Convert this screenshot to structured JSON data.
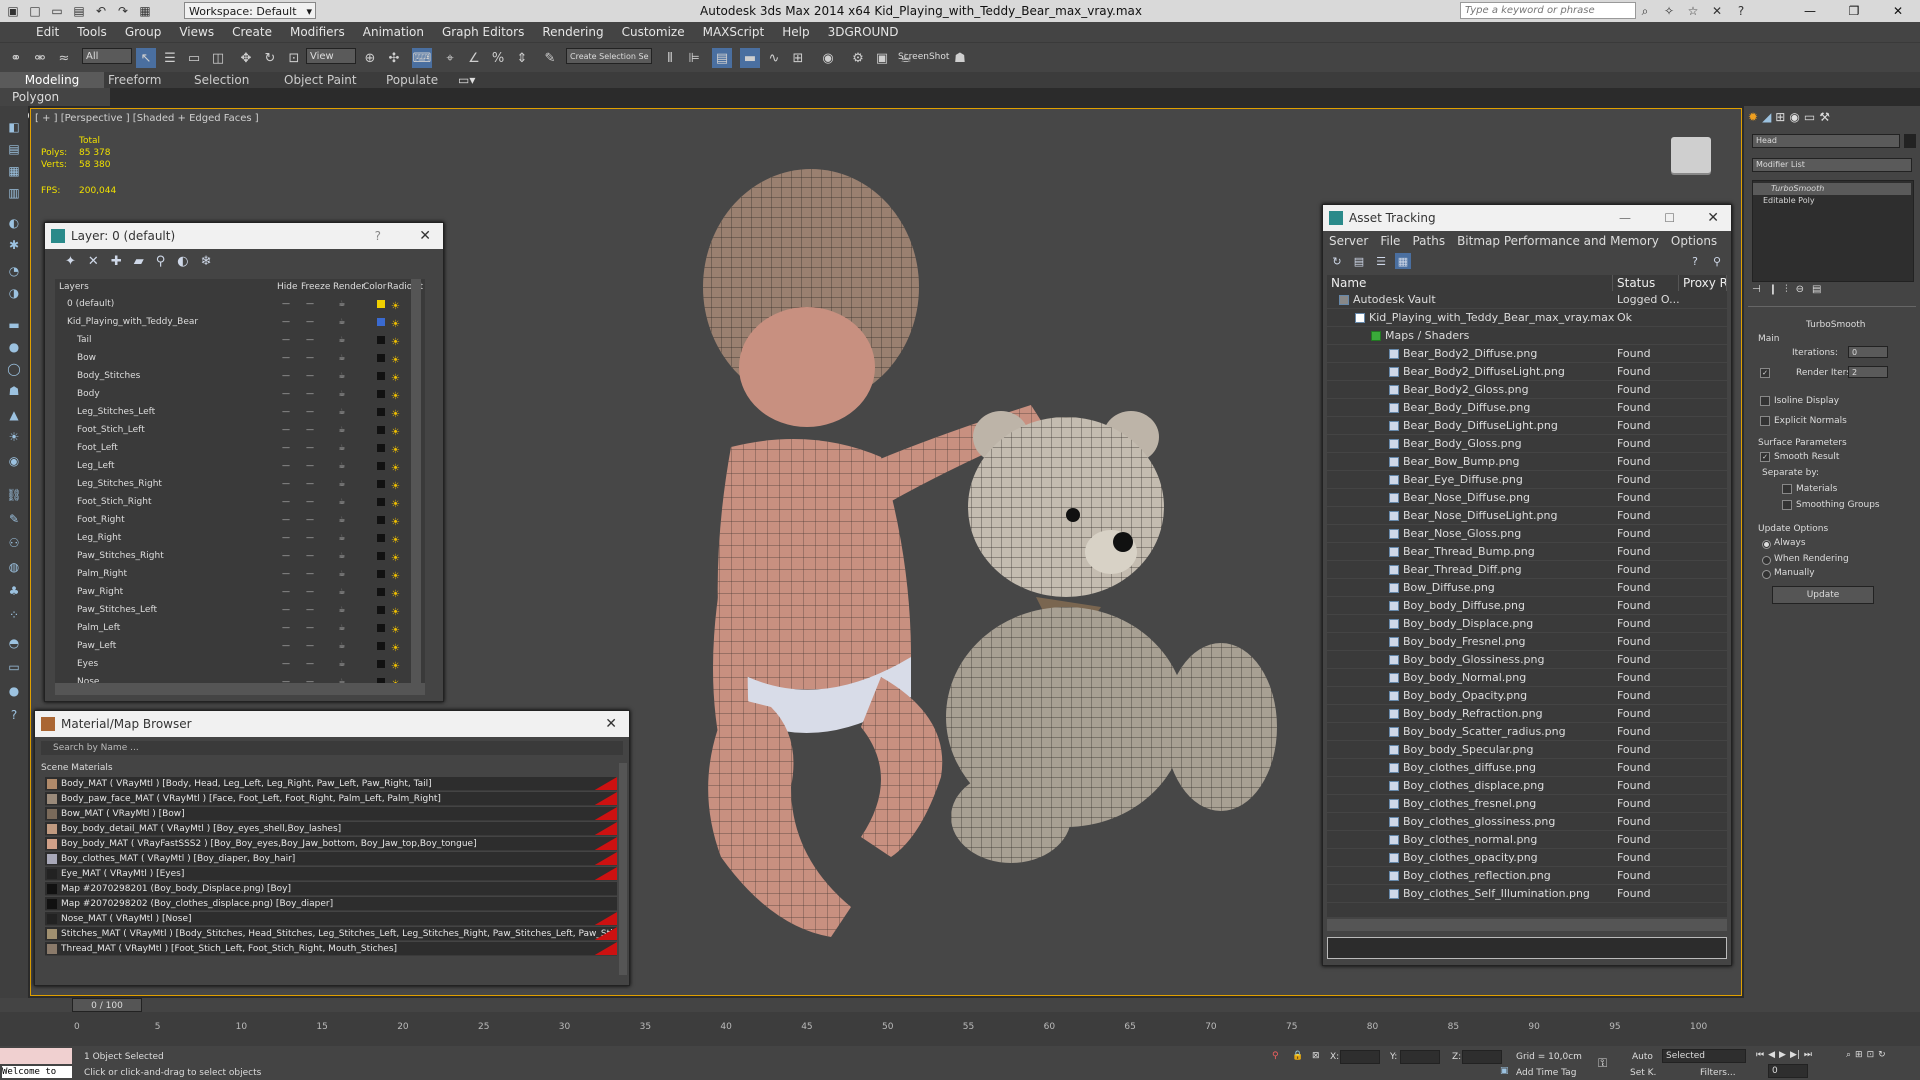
{
  "titlebar": {
    "title": "Autodesk 3ds Max  2014 x64    Kid_Playing_with_Teddy_Bear_max_vray.max",
    "workspace": "Workspace: Default",
    "search_placeholder": "Type a keyword or phrase"
  },
  "menu": [
    "Edit",
    "Tools",
    "Group",
    "Views",
    "Create",
    "Modifiers",
    "Animation",
    "Graph Editors",
    "Rendering",
    "Customize",
    "MAXScript",
    "Help",
    "3DGROUND"
  ],
  "toolbar": {
    "filter": "All",
    "ref_coord": "View",
    "named_sel": "Create Selection Se",
    "screenshot": "ScreenShot"
  },
  "ribbon": {
    "tabs": [
      "Modeling",
      "Freeform",
      "Selection",
      "Object Paint",
      "Populate"
    ],
    "subtab": "Polygon Modeling"
  },
  "viewport": {
    "label": "[ + ] [Perspective ] [Shaded + Edged Faces ]",
    "stats_total": "Total",
    "polys_label": "Polys:",
    "polys": "85 378",
    "verts_label": "Verts:",
    "verts": "58 380",
    "fps_label": "FPS:",
    "fps": "200,044"
  },
  "layer_dialog": {
    "title": "Layer: 0 (default)",
    "help": "?",
    "columns": [
      "Layers",
      "Hide",
      "Freeze",
      "Render",
      "Color",
      "Radiosit"
    ],
    "rows": [
      {
        "name": "0 (default)",
        "indent": 0,
        "color": "#f0d000"
      },
      {
        "name": "Kid_Playing_with_Teddy_Bear",
        "indent": 0,
        "color": "#3a6ad0"
      },
      {
        "name": "Tail",
        "indent": 1,
        "color": "#111111"
      },
      {
        "name": "Bow",
        "indent": 1,
        "color": "#111111"
      },
      {
        "name": "Body_Stitches",
        "indent": 1,
        "color": "#111111"
      },
      {
        "name": "Body",
        "indent": 1,
        "color": "#111111"
      },
      {
        "name": "Leg_Stitches_Left",
        "indent": 1,
        "color": "#111111"
      },
      {
        "name": "Foot_Stich_Left",
        "indent": 1,
        "color": "#111111"
      },
      {
        "name": "Foot_Left",
        "indent": 1,
        "color": "#111111"
      },
      {
        "name": "Leg_Left",
        "indent": 1,
        "color": "#111111"
      },
      {
        "name": "Leg_Stitches_Right",
        "indent": 1,
        "color": "#111111"
      },
      {
        "name": "Foot_Stich_Right",
        "indent": 1,
        "color": "#111111"
      },
      {
        "name": "Foot_Right",
        "indent": 1,
        "color": "#111111"
      },
      {
        "name": "Leg_Right",
        "indent": 1,
        "color": "#111111"
      },
      {
        "name": "Paw_Stitches_Right",
        "indent": 1,
        "color": "#111111"
      },
      {
        "name": "Palm_Right",
        "indent": 1,
        "color": "#111111"
      },
      {
        "name": "Paw_Right",
        "indent": 1,
        "color": "#111111"
      },
      {
        "name": "Paw_Stitches_Left",
        "indent": 1,
        "color": "#111111"
      },
      {
        "name": "Palm_Left",
        "indent": 1,
        "color": "#111111"
      },
      {
        "name": "Paw_Left",
        "indent": 1,
        "color": "#111111"
      },
      {
        "name": "Eyes",
        "indent": 1,
        "color": "#111111"
      },
      {
        "name": "Nose",
        "indent": 1,
        "color": "#111111"
      }
    ]
  },
  "material_browser": {
    "title": "Material/Map Browser",
    "search": "Search by Name ...",
    "section": "Scene Materials",
    "rows": [
      {
        "text": "Body_MAT  ( VRayMtl )  [Body, Head, Leg_Left, Leg_Right, Paw_Left, Paw_Right, Tail]",
        "icon": "#b08a6a",
        "red": true
      },
      {
        "text": "Body_paw_face_MAT  ( VRayMtl )  [Face, Foot_Left, Foot_Right, Palm_Left, Palm_Right]",
        "icon": "#9a8a7a",
        "red": true
      },
      {
        "text": "Bow_MAT  ( VRayMtl )  [Bow]",
        "icon": "#7a6a5a",
        "red": true
      },
      {
        "text": "Boy_body_detail_MAT  ( VRayMtl )  [Boy_eyes_shell,Boy_lashes]",
        "icon": "#c09a80",
        "red": true
      },
      {
        "text": "Boy_body_MAT  ( VRayFastSSS2 )  [Boy_Boy_eyes,Boy_Jaw_bottom, Boy_Jaw_top,Boy_tongue]",
        "icon": "#d0a088",
        "red": true
      },
      {
        "text": "Boy_clothes_MAT  ( VRayMtl )  [Boy_diaper, Boy_hair]",
        "icon": "#a8a8b8",
        "red": true
      },
      {
        "text": "Eye_MAT  ( VRayMtl )  [Eyes]",
        "icon": "#222222",
        "red": true
      },
      {
        "text": "Map #2070298201  (Boy_body_Displace.png)  [Boy]",
        "icon": "#111111",
        "red": false
      },
      {
        "text": "Map #2070298202  (Boy_clothes_displace.png)  [Boy_diaper]",
        "icon": "#111111",
        "red": false
      },
      {
        "text": "Nose_MAT  ( VRayMtl )  [Nose]",
        "icon": "#222222",
        "red": true
      },
      {
        "text": "Stitches_MAT  ( VRayMtl )  [Body_Stitches, Head_Stitches, Leg_Stitches_Left, Leg_Stitches_Right, Paw_Stitches_Left, Paw_Stitches_Right]",
        "icon": "#a09070",
        "red": true
      },
      {
        "text": "Thread_MAT  ( VRayMtl )  [Foot_Stich_Left, Foot_Stich_Right, Mouth_Stiches]",
        "icon": "#8a7a6a",
        "red": true
      }
    ]
  },
  "asset_tracking": {
    "title": "Asset Tracking",
    "menu": [
      "Server",
      "File",
      "Paths",
      "Bitmap Performance and Memory",
      "Options"
    ],
    "columns": [
      "Name",
      "Status",
      "Proxy Res"
    ],
    "rows": [
      {
        "name": "Autodesk Vault",
        "status": "Logged O...",
        "indent": 0,
        "kind": "vault"
      },
      {
        "name": "Kid_Playing_with_Teddy_Bear_max_vray.max",
        "status": "Ok",
        "indent": 1,
        "kind": "max"
      },
      {
        "name": "Maps / Shaders",
        "status": "",
        "indent": 2,
        "kind": "folder"
      },
      {
        "name": "Bear_Body2_Diffuse.png",
        "status": "Found",
        "indent": 3,
        "kind": "file"
      },
      {
        "name": "Bear_Body2_DiffuseLight.png",
        "status": "Found",
        "indent": 3,
        "kind": "file"
      },
      {
        "name": "Bear_Body2_Gloss.png",
        "status": "Found",
        "indent": 3,
        "kind": "file"
      },
      {
        "name": "Bear_Body_Diffuse.png",
        "status": "Found",
        "indent": 3,
        "kind": "file"
      },
      {
        "name": "Bear_Body_DiffuseLight.png",
        "status": "Found",
        "indent": 3,
        "kind": "file"
      },
      {
        "name": "Bear_Body_Gloss.png",
        "status": "Found",
        "indent": 3,
        "kind": "file"
      },
      {
        "name": "Bear_Bow_Bump.png",
        "status": "Found",
        "indent": 3,
        "kind": "file"
      },
      {
        "name": "Bear_Eye_Diffuse.png",
        "status": "Found",
        "indent": 3,
        "kind": "file"
      },
      {
        "name": "Bear_Nose_Diffuse.png",
        "status": "Found",
        "indent": 3,
        "kind": "file"
      },
      {
        "name": "Bear_Nose_DiffuseLight.png",
        "status": "Found",
        "indent": 3,
        "kind": "file"
      },
      {
        "name": "Bear_Nose_Gloss.png",
        "status": "Found",
        "indent": 3,
        "kind": "file"
      },
      {
        "name": "Bear_Thread_Bump.png",
        "status": "Found",
        "indent": 3,
        "kind": "file"
      },
      {
        "name": "Bear_Thread_Diff.png",
        "status": "Found",
        "indent": 3,
        "kind": "file"
      },
      {
        "name": "Bow_Diffuse.png",
        "status": "Found",
        "indent": 3,
        "kind": "file"
      },
      {
        "name": "Boy_body_Diffuse.png",
        "status": "Found",
        "indent": 3,
        "kind": "file"
      },
      {
        "name": "Boy_body_Displace.png",
        "status": "Found",
        "indent": 3,
        "kind": "file"
      },
      {
        "name": "Boy_body_Fresnel.png",
        "status": "Found",
        "indent": 3,
        "kind": "file"
      },
      {
        "name": "Boy_body_Glossiness.png",
        "status": "Found",
        "indent": 3,
        "kind": "file"
      },
      {
        "name": "Boy_body_Normal.png",
        "status": "Found",
        "indent": 3,
        "kind": "file"
      },
      {
        "name": "Boy_body_Opacity.png",
        "status": "Found",
        "indent": 3,
        "kind": "file"
      },
      {
        "name": "Boy_body_Refraction.png",
        "status": "Found",
        "indent": 3,
        "kind": "file"
      },
      {
        "name": "Boy_body_Scatter_radius.png",
        "status": "Found",
        "indent": 3,
        "kind": "file"
      },
      {
        "name": "Boy_body_Specular.png",
        "status": "Found",
        "indent": 3,
        "kind": "file"
      },
      {
        "name": "Boy_clothes_diffuse.png",
        "status": "Found",
        "indent": 3,
        "kind": "file"
      },
      {
        "name": "Boy_clothes_displace.png",
        "status": "Found",
        "indent": 3,
        "kind": "file"
      },
      {
        "name": "Boy_clothes_fresnel.png",
        "status": "Found",
        "indent": 3,
        "kind": "file"
      },
      {
        "name": "Boy_clothes_glossiness.png",
        "status": "Found",
        "indent": 3,
        "kind": "file"
      },
      {
        "name": "Boy_clothes_normal.png",
        "status": "Found",
        "indent": 3,
        "kind": "file"
      },
      {
        "name": "Boy_clothes_opacity.png",
        "status": "Found",
        "indent": 3,
        "kind": "file"
      },
      {
        "name": "Boy_clothes_reflection.png",
        "status": "Found",
        "indent": 3,
        "kind": "file"
      },
      {
        "name": "Boy_clothes_Self_Illumination.png",
        "status": "Found",
        "indent": 3,
        "kind": "file"
      }
    ]
  },
  "command_panel": {
    "object_name": "Head",
    "modifier_list": "Modifier List",
    "stack": [
      "TurboSmooth",
      "Editable Poly"
    ],
    "rollout": "TurboSmooth",
    "main": "Main",
    "iterations_label": "Iterations:",
    "iterations": "0",
    "render_iters_label": "Render Iters:",
    "render_iters": "2",
    "isoline": "Isoline Display",
    "explicit_normals": "Explicit Normals",
    "surface_params": "Surface Parameters",
    "smooth_result": "Smooth Result",
    "separate_by": "Separate by:",
    "materials": "Materials",
    "smoothing_groups": "Smoothing Groups",
    "update_options": "Update Options",
    "always": "Always",
    "when_rendering": "When Rendering",
    "manually": "Manually",
    "update": "Update"
  },
  "timeline": {
    "slider": "0 / 100",
    "ticks": [
      "0",
      "5",
      "10",
      "15",
      "20",
      "25",
      "30",
      "35",
      "40",
      "45",
      "50",
      "55",
      "60",
      "65",
      "70",
      "75",
      "80",
      "85",
      "90",
      "95",
      "100"
    ]
  },
  "status": {
    "maxscript": "Welcome to",
    "selected": "1 Object Selected",
    "prompt": "Click or click-and-drag to select objects",
    "x_label": "X:",
    "y_label": "Y:",
    "z_label": "Z:",
    "grid": "Grid = 10,0cm",
    "add_time_tag": "Add Time Tag",
    "auto": "Auto",
    "set_key": "Set K.",
    "selected_dd": "Selected",
    "filters": "Filters...",
    "frame": "0"
  }
}
